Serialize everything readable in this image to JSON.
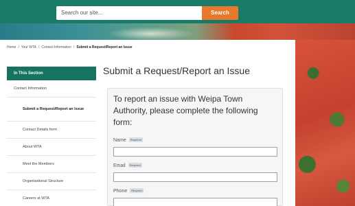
{
  "header": {
    "search_placeholder": "Search our site...",
    "search_button": "Search"
  },
  "breadcrumb": {
    "items": [
      "Home",
      "/",
      "Your WTA",
      "/",
      "Contact Information",
      "/"
    ],
    "current": "Submit a Request/Report an Issue"
  },
  "sidebar": {
    "heading": "In This Section",
    "items": [
      {
        "label": "Contact Information"
      },
      {
        "label": "Submit a Request/Report an Issue"
      },
      {
        "label": "Contact Details form"
      },
      {
        "label": "About WTA"
      },
      {
        "label": "Meet the Members"
      },
      {
        "label": "Organisational Structure"
      },
      {
        "label": "Careers at WTA"
      }
    ]
  },
  "main": {
    "title": "Submit a Request/Report an Issue",
    "intro": "To report an issue with Weipa Town Authority, please complete the following form:",
    "required_tag": "Required",
    "fields": [
      {
        "label": "Name"
      },
      {
        "label": "Email"
      },
      {
        "label": "Phone"
      }
    ]
  },
  "colors": {
    "brand_green": "#1a7a68",
    "section_green": "#16735f",
    "accent_orange": "#e6792b"
  }
}
